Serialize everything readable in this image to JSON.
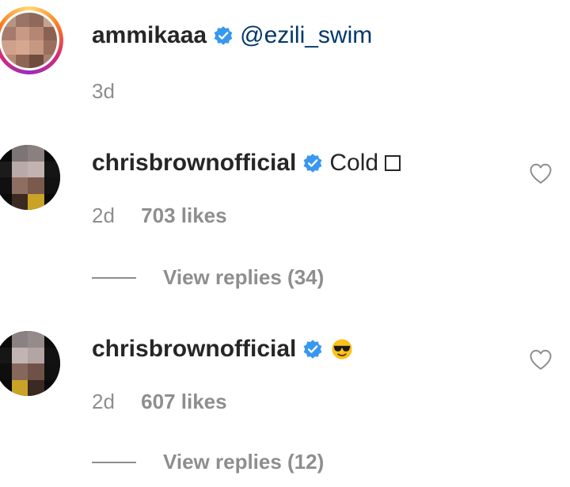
{
  "comments": [
    {
      "username": "ammikaaa",
      "text": "@ezili_swim",
      "time": "3d",
      "likes": "",
      "replies": ""
    },
    {
      "username": "chrisbrownofficial",
      "text": "Cold",
      "time": "2d",
      "likes": "703 likes",
      "replies": "View replies (34)"
    },
    {
      "username": "chrisbrownofficial",
      "text": "",
      "time": "2d",
      "likes": "607 likes",
      "replies": "View replies (12)"
    }
  ],
  "icons": {
    "verified": "verified-badge-icon",
    "heart": "heart-outline-icon",
    "emoji": "sunglasses-emoji-icon",
    "box": "missing-glyph-box"
  },
  "colors": {
    "verified": "#3897f0",
    "secondary_text": "#8e8e8e",
    "mention": "#00376b",
    "primary_text": "#262626"
  }
}
